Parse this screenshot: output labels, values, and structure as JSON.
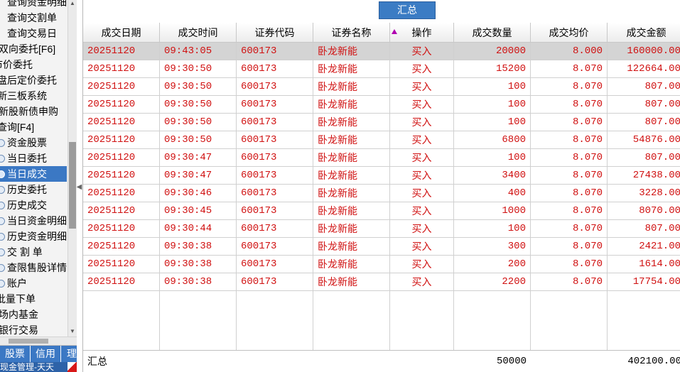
{
  "sidebar": {
    "items": [
      {
        "label": "查询资金明细",
        "icon": "",
        "selected": false
      },
      {
        "label": "查询交割单",
        "icon": "",
        "selected": false
      },
      {
        "label": "查询交易日",
        "icon": "",
        "selected": false
      },
      {
        "label": "双向委托[F6]",
        "icon": "",
        "selected": false
      },
      {
        "label": "市价委托",
        "icon": "",
        "selected": false
      },
      {
        "label": "盘后定价委托",
        "icon": "",
        "selected": false
      },
      {
        "label": "新三板系统",
        "icon": "",
        "selected": false
      },
      {
        "label": "新股新债申购",
        "icon": "",
        "selected": false
      },
      {
        "label": "查询[F4]",
        "icon": "",
        "selected": false
      },
      {
        "label": "资金股票",
        "icon": "doc-icon",
        "selected": false
      },
      {
        "label": "当日委托",
        "icon": "doc-icon",
        "selected": false
      },
      {
        "label": "当日成交",
        "icon": "doc-icon",
        "selected": true
      },
      {
        "label": "历史委托",
        "icon": "doc-icon",
        "selected": false
      },
      {
        "label": "历史成交",
        "icon": "doc-icon",
        "selected": false
      },
      {
        "label": "当日资金明细",
        "icon": "doc-icon",
        "selected": false
      },
      {
        "label": "历史资金明细",
        "icon": "doc-icon",
        "selected": false
      },
      {
        "label": "交 割 单",
        "icon": "doc-icon",
        "selected": false
      },
      {
        "label": "查限售股详情",
        "icon": "doc-icon",
        "selected": false
      },
      {
        "label": "账户",
        "icon": "doc-icon",
        "selected": false
      },
      {
        "label": "批量下单",
        "icon": "",
        "selected": false
      },
      {
        "label": "场内基金",
        "icon": "",
        "selected": false
      },
      {
        "label": "银行交易",
        "icon": "",
        "selected": false
      }
    ],
    "tabs": [
      "股票",
      "信用",
      "理"
    ],
    "status_text": "现金管理-天天"
  },
  "summary_button": "汇总",
  "table": {
    "columns": [
      "成交日期",
      "成交时间",
      "证券代码",
      "证券名称",
      "操作",
      "成交数量",
      "成交均价",
      "成交金额"
    ],
    "rows": [
      [
        "20251120",
        "09:43:05",
        "600173",
        "卧龙新能",
        "买入",
        "20000",
        "8.000",
        "160000.00"
      ],
      [
        "20251120",
        "09:30:50",
        "600173",
        "卧龙新能",
        "买入",
        "15200",
        "8.070",
        "122664.00"
      ],
      [
        "20251120",
        "09:30:50",
        "600173",
        "卧龙新能",
        "买入",
        "100",
        "8.070",
        "807.00"
      ],
      [
        "20251120",
        "09:30:50",
        "600173",
        "卧龙新能",
        "买入",
        "100",
        "8.070",
        "807.00"
      ],
      [
        "20251120",
        "09:30:50",
        "600173",
        "卧龙新能",
        "买入",
        "100",
        "8.070",
        "807.00"
      ],
      [
        "20251120",
        "09:30:50",
        "600173",
        "卧龙新能",
        "买入",
        "6800",
        "8.070",
        "54876.00"
      ],
      [
        "20251120",
        "09:30:47",
        "600173",
        "卧龙新能",
        "买入",
        "100",
        "8.070",
        "807.00"
      ],
      [
        "20251120",
        "09:30:47",
        "600173",
        "卧龙新能",
        "买入",
        "3400",
        "8.070",
        "27438.00"
      ],
      [
        "20251120",
        "09:30:46",
        "600173",
        "卧龙新能",
        "买入",
        "400",
        "8.070",
        "3228.00"
      ],
      [
        "20251120",
        "09:30:45",
        "600173",
        "卧龙新能",
        "买入",
        "1000",
        "8.070",
        "8070.00"
      ],
      [
        "20251120",
        "09:30:44",
        "600173",
        "卧龙新能",
        "买入",
        "100",
        "8.070",
        "807.00"
      ],
      [
        "20251120",
        "09:30:38",
        "600173",
        "卧龙新能",
        "买入",
        "300",
        "8.070",
        "2421.00"
      ],
      [
        "20251120",
        "09:30:38",
        "600173",
        "卧龙新能",
        "买入",
        "200",
        "8.070",
        "1614.00"
      ],
      [
        "20251120",
        "09:30:38",
        "600173",
        "卧龙新能",
        "买入",
        "2200",
        "8.070",
        "17754.00"
      ]
    ],
    "selected_row": 0,
    "total": {
      "label": "汇总",
      "quantity": "50000",
      "amount": "402100.00"
    }
  },
  "colors": {
    "row_text": "#d01010",
    "accent": "#3b78c4"
  }
}
